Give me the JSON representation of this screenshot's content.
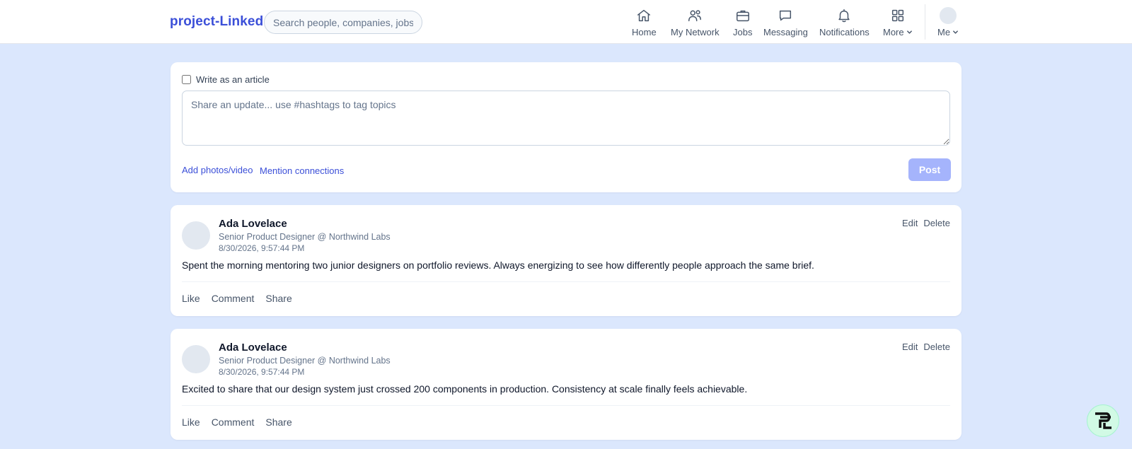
{
  "header": {
    "logo": "project-Linked",
    "search_placeholder": "Search people, companies, jobs",
    "nav": {
      "home": "Home",
      "network": "My Network",
      "jobs": "Jobs",
      "messaging": "Messaging",
      "notifications": "Notifications",
      "more": "More",
      "me": "Me"
    }
  },
  "composer": {
    "article_label": "Write as an article",
    "placeholder": "Share an update... use #hashtags to tag topics",
    "add_media": "Add photos/video",
    "mention": "Mention connections",
    "post_button": "Post"
  },
  "posts": [
    {
      "author": "Ada Lovelace",
      "headline": "Senior Product Designer @ Northwind Labs",
      "time": "8/30/2026, 9:57:44 PM",
      "text": "Spent the morning mentoring two junior designers on portfolio reviews. Always energizing to see how differently people approach the same brief.",
      "edit": "Edit",
      "delete": "Delete",
      "like": "Like",
      "comment": "Comment",
      "share": "Share"
    },
    {
      "author": "Ada Lovelace",
      "headline": "Senior Product Designer @ Northwind Labs",
      "time": "8/30/2026, 9:57:44 PM",
      "text": "Excited to share that our design system just crossed 200 components in production. Consistency at scale finally feels achievable.",
      "edit": "Edit",
      "delete": "Delete",
      "like": "Like",
      "comment": "Comment",
      "share": "Share"
    }
  ],
  "colors": {
    "page_bg": "#dbe7fd",
    "brand": "#3b4fd8",
    "post_button": "#a5b4fc"
  },
  "icons": [
    "home-icon",
    "network-icon",
    "briefcase-icon",
    "message-icon",
    "bell-icon",
    "grid-icon",
    "chevron-down-icon",
    "avatar",
    "floating-logo"
  ]
}
